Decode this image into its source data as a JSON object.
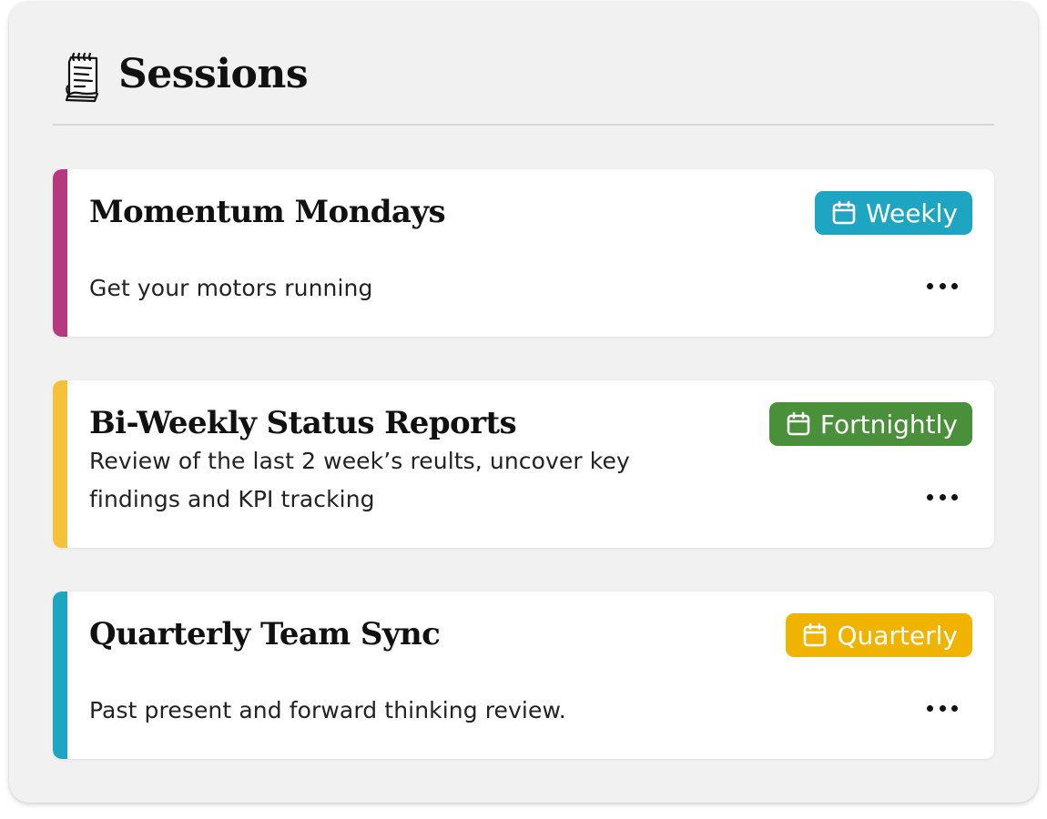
{
  "header": {
    "title": "Sessions",
    "icon": "notepad-icon"
  },
  "sessions": [
    {
      "title": "Momentum Mondays",
      "description": "Get your motors running",
      "frequency": "Weekly",
      "accent_color": "#b5397f",
      "badge_color": "#1ea5c1",
      "badge_icon": "calendar-icon",
      "more_icon": "more-icon"
    },
    {
      "title": "Bi-Weekly Status Reports",
      "description": "Review of the last 2 week’s reults, uncover key findings and KPI tracking",
      "frequency": "Fortnightly",
      "accent_color": "#f3c13a",
      "badge_color": "#4a8f3a",
      "badge_icon": "calendar-icon",
      "more_icon": "more-icon"
    },
    {
      "title": "Quarterly Team Sync",
      "description": "Past present and forward thinking review.",
      "frequency": "Quarterly",
      "accent_color": "#1ea5c1",
      "badge_color": "#f0b400",
      "badge_icon": "calendar-icon",
      "more_icon": "more-icon"
    }
  ]
}
